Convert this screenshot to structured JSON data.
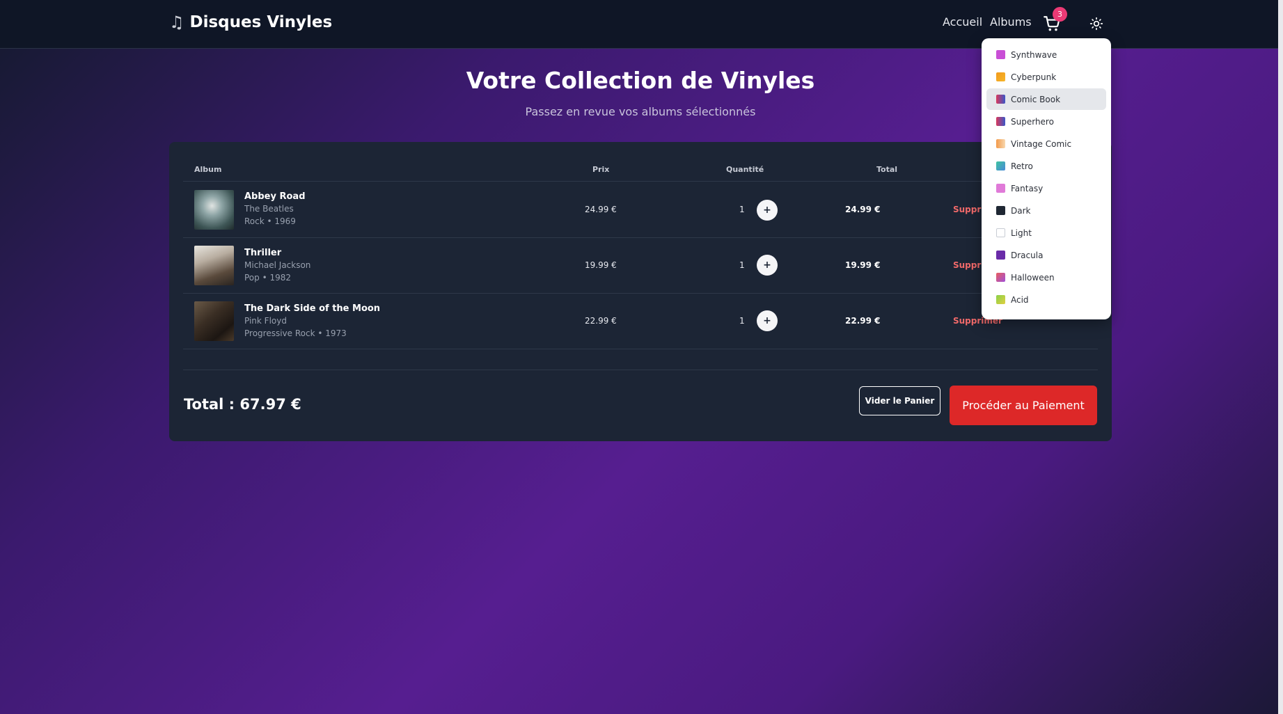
{
  "navbar": {
    "brand": "Disques Vinyles",
    "brand_icon": "music-note-icon",
    "links": {
      "home": "Accueil",
      "albums": "Albums"
    },
    "cart_count": "3",
    "cart_icon": "cart-icon",
    "theme_icon": "sun-icon"
  },
  "header": {
    "title": "Votre Collection de Vinyles",
    "subtitle": "Passez en revue vos albums sélectionnés"
  },
  "table": {
    "columns": {
      "album": "Album",
      "price": "Prix",
      "quantity": "Quantité",
      "total": "Total"
    },
    "rows": [
      {
        "title": "Abbey Road",
        "artist": "The Beatles",
        "meta": "Rock • 1969",
        "price": "24.99 €",
        "quantity": "1",
        "plus": "+",
        "total": "24.99 €",
        "remove": "Supprimer"
      },
      {
        "title": "Thriller",
        "artist": "Michael Jackson",
        "meta": "Pop • 1982",
        "price": "19.99 €",
        "quantity": "1",
        "plus": "+",
        "total": "19.99 €",
        "remove": "Supprimer"
      },
      {
        "title": "The Dark Side of the Moon",
        "artist": "Pink Floyd",
        "meta": "Progressive Rock • 1973",
        "price": "22.99 €",
        "quantity": "1",
        "plus": "+",
        "total": "22.99 €",
        "remove": "Supprimer"
      }
    ]
  },
  "summary": {
    "total": "Total : 67.97 €",
    "clear_button": "Vider le Panier",
    "pay_button": "Procéder au Paiement"
  },
  "theme_menu": {
    "active": "Comic Book",
    "items": [
      {
        "label": "Synthwave",
        "color": "#c94fd6"
      },
      {
        "label": "Cyberpunk",
        "color": "#f29a1c"
      },
      {
        "label": "Comic Book",
        "color": "#c23a74"
      },
      {
        "label": "Superhero",
        "color": "#c0356e"
      },
      {
        "label": "Vintage Comic",
        "color": "#f0a060"
      },
      {
        "label": "Retro",
        "color": "#3cb4a8"
      },
      {
        "label": "Fantasy",
        "color": "#e07ad8"
      },
      {
        "label": "Dark",
        "color": "#1f2733"
      },
      {
        "label": "Light",
        "color": "#ffffff"
      },
      {
        "label": "Dracula",
        "color": "#6a2ca8"
      },
      {
        "label": "Halloween",
        "color": "#e85e5e"
      },
      {
        "label": "Acid",
        "color": "#8ad14a"
      }
    ]
  },
  "colors": {
    "accent": "#dd2828",
    "badge": "#ec3a75",
    "remove": "#f26a6a"
  }
}
